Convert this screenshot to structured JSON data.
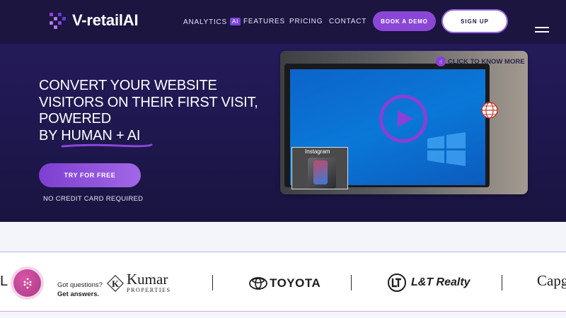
{
  "brand": {
    "name": "V-retailAI",
    "accent": "#8a47d6"
  },
  "nav": {
    "links": [
      {
        "label": "ANALYTICS",
        "badge": "AI"
      },
      {
        "label": "FEATURES"
      },
      {
        "label": "PRICING"
      },
      {
        "label": "CONTACT"
      }
    ],
    "demo_label": "BOOK A DEMO",
    "signup_label": "SIGN UP",
    "menu_icon": "hamburger-menu-icon"
  },
  "hero": {
    "headline_lines": [
      "CONVERT YOUR WEBSITE",
      "VISITORS ON THEIR FIRST VISIT,",
      "POWERED"
    ],
    "headline_by": "BY ",
    "headline_highlight": "HUMAN + AI",
    "cta_label": "TRY FOR FREE",
    "cta_note": "NO CREDIT CARD REQUIRED"
  },
  "video": {
    "overlay_text": "CLICK TO KNOW MORE",
    "pip_label": "Instagram",
    "play_icon": "play-icon",
    "globe_icon": "globe-icon",
    "click_icon": "pointer-click-icon"
  },
  "chat": {
    "line1": "Got questions?",
    "line2": "Get answers."
  },
  "clients": {
    "left_partial": "L L",
    "kumar_main": "Kumar",
    "kumar_sub": "PROPERTIES",
    "toyota": "TOYOTA",
    "lt": "L&T Realty",
    "partial_right": "Capg"
  }
}
